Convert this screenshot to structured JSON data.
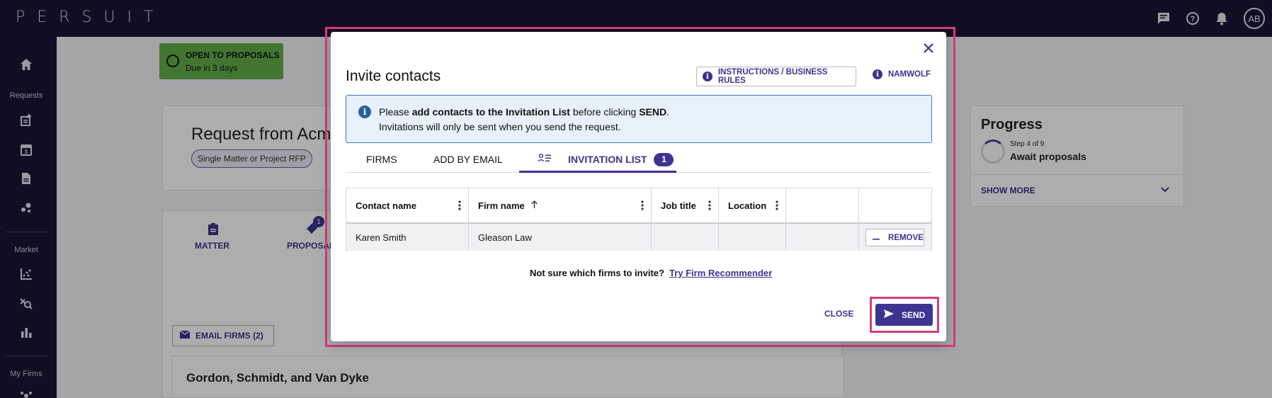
{
  "app": {
    "logo": "PERSUIT",
    "avatar_initials": "AB"
  },
  "topbar": {
    "icons": [
      "chat-icon",
      "help-icon",
      "bell-icon"
    ]
  },
  "leftnav": {
    "sections": [
      {
        "label": "Requests",
        "icons": [
          "add-request-icon",
          "calendar-icon",
          "document-icon",
          "network-icon"
        ]
      },
      {
        "label": "Market",
        "icons": [
          "scatter-chart-icon",
          "analytics-icon",
          "bar-chart-icon"
        ]
      },
      {
        "label": "My Firms",
        "icons": [
          "firms-icon"
        ]
      }
    ],
    "home_icon": "home-icon"
  },
  "background": {
    "status_title": "OPEN TO PROPOSALS",
    "status_due": "Due in 3 days",
    "request_title": "Request from Acm",
    "request_type": "Single Matter or Project RFP",
    "tabs": [
      "MATTER",
      "PROPOSAL"
    ],
    "proposal_badge": "1",
    "email_firms": "EMAIL FIRMS (2)",
    "firm_name": "Gordon, Schmidt, and Van Dyke",
    "progress": {
      "title": "Progress",
      "step": "Step 4 of 9",
      "stage": "Await proposals",
      "show_more": "SHOW MORE"
    }
  },
  "modal": {
    "title": "Invite contacts",
    "instructions_label": "INSTRUCTIONS / BUSINESS RULES",
    "namwolf_label": "NAMWOLF",
    "alert": {
      "prefix": "Please ",
      "bold1": "add contacts to the Invitation List",
      "middle": " before clicking ",
      "bold2": "SEND",
      "suffix": ".",
      "line2": "Invitations will only be sent when you send the request."
    },
    "tabs": [
      {
        "label": "FIRMS"
      },
      {
        "label": "ADD BY EMAIL"
      },
      {
        "label": "INVITATION LIST",
        "count": "1"
      }
    ],
    "table": {
      "columns": [
        "Contact name",
        "Firm name",
        "Job title",
        "Location"
      ],
      "rows": [
        {
          "contact": "Karen Smith",
          "firm": "Gleason Law",
          "job_title": "",
          "location": ""
        }
      ],
      "remove_label": "REMOVE"
    },
    "recommend_text": "Not sure which firms to invite?",
    "recommend_link": "Try Firm Recommender",
    "close_label": "CLOSE",
    "send_label": "SEND"
  },
  "colors": {
    "brand": "#3d3490",
    "nav_bg": "#1c1436",
    "highlight": "#d63c7c",
    "status_green": "#62ad4a",
    "alert_bg": "#e7f1fb"
  }
}
